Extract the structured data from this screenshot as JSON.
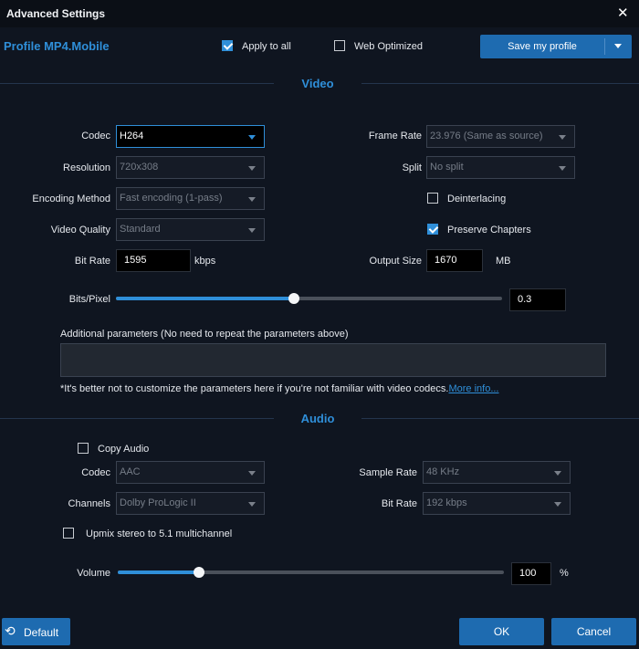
{
  "window": {
    "title": "Advanced Settings",
    "close_glyph": "✕"
  },
  "header": {
    "profile_name": "Profile MP4.Mobile",
    "apply_to_all": {
      "label": "Apply to all",
      "checked": true
    },
    "web_optimized": {
      "label": "Web Optimized",
      "checked": false
    },
    "save_profile": {
      "label": "Save my profile"
    }
  },
  "video": {
    "section_title": "Video",
    "codec": {
      "label": "Codec",
      "value": "H264"
    },
    "resolution": {
      "label": "Resolution",
      "value": "720x308"
    },
    "encoding_method": {
      "label": "Encoding Method",
      "value": "Fast encoding (1-pass)"
    },
    "video_quality": {
      "label": "Video Quality",
      "value": "Standard"
    },
    "bit_rate": {
      "label": "Bit Rate",
      "value": "1595",
      "unit": "kbps"
    },
    "frame_rate": {
      "label": "Frame Rate",
      "value": "23.976 (Same as source)"
    },
    "split": {
      "label": "Split",
      "value": "No split"
    },
    "deinterlacing": {
      "label": "Deinterlacing",
      "checked": false
    },
    "preserve_chapters": {
      "label": "Preserve Chapters",
      "checked": true
    },
    "output_size": {
      "label": "Output Size",
      "value": "1670",
      "unit": "MB"
    },
    "bits_per_pixel": {
      "label": "Bits/Pixel",
      "value": "0.3",
      "level": 0.46
    },
    "additional_params_label": "Additional parameters (No need to repeat the parameters above)",
    "additional_params_value": "",
    "note": "*It's better not to customize the parameters here if you're not familiar with video codecs.",
    "more_info": "More info..."
  },
  "audio": {
    "section_title": "Audio",
    "copy_audio": {
      "label": "Copy Audio",
      "checked": false
    },
    "codec": {
      "label": "Codec",
      "value": "AAC"
    },
    "channels": {
      "label": "Channels",
      "value": "Dolby ProLogic II"
    },
    "sample_rate": {
      "label": "Sample Rate",
      "value": "48 KHz"
    },
    "bit_rate": {
      "label": "Bit Rate",
      "value": "192 kbps"
    },
    "upmix": {
      "label": "Upmix stereo to 5.1 multichannel",
      "checked": false
    },
    "volume": {
      "label": "Volume",
      "value": "100",
      "unit": "%",
      "level": 0.21
    }
  },
  "footer": {
    "default_label": "Default",
    "ok_label": "OK",
    "cancel_label": "Cancel"
  },
  "colors": {
    "accent": "#2f8fd9",
    "background": "#0f1520",
    "button": "#1e6bb0"
  }
}
